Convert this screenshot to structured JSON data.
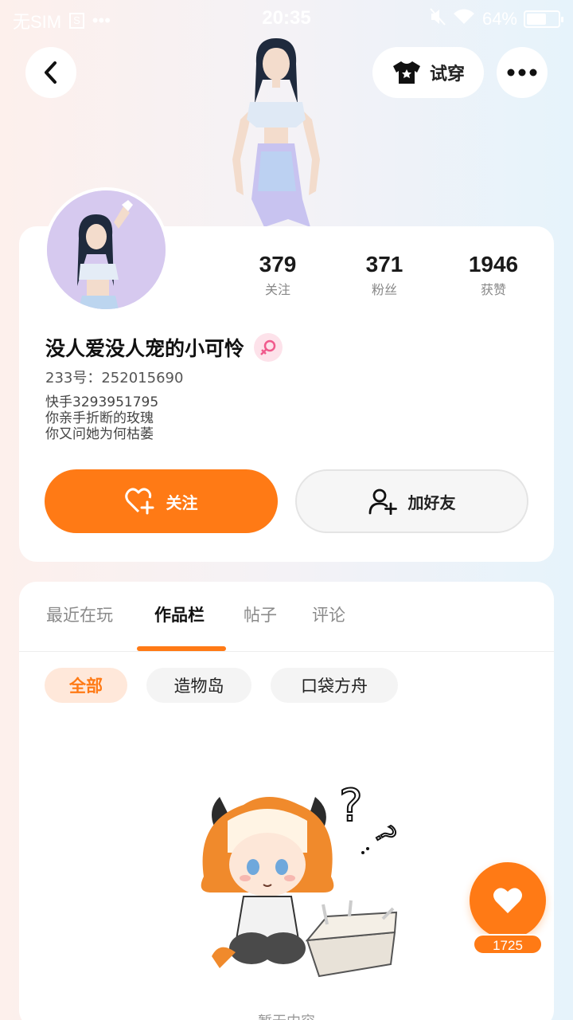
{
  "status_bar": {
    "carrier": "无SIM",
    "sim_icon_label": "S",
    "dots": "•••",
    "time": "20:35",
    "battery_text": "64%",
    "battery_level": 0.64
  },
  "top_bar": {
    "back_icon": "chevron-left-icon",
    "try_on_label": "试穿",
    "try_on_icon": "tshirt-icon",
    "more_icon": "more-dots-icon"
  },
  "profile": {
    "stats": [
      {
        "value": "379",
        "label": "关注"
      },
      {
        "value": "371",
        "label": "粉丝"
      },
      {
        "value": "1946",
        "label": "获赞"
      }
    ],
    "username": "没人爱没人宠的小可怜",
    "gender_icon": "female-icon",
    "uid": "233号：252015690",
    "bio": [
      "快手3293951795",
      "你亲手折断的玫瑰",
      "你又问她为何枯萎"
    ],
    "follow_label": "关注",
    "add_friend_label": "加好友"
  },
  "tabs": {
    "items": [
      "最近在玩",
      "作品栏",
      "帖子",
      "评论"
    ],
    "active": "作品栏"
  },
  "filters": {
    "items": [
      "全部",
      "造物岛",
      "口袋方舟"
    ],
    "active": "全部"
  },
  "empty_state": {
    "text": "暂无内容"
  },
  "like_fab": {
    "count": "1725"
  },
  "colors": {
    "accent": "#ff7a15",
    "accent_light": "#ffe8da",
    "female_pink": "#f05a8c"
  }
}
